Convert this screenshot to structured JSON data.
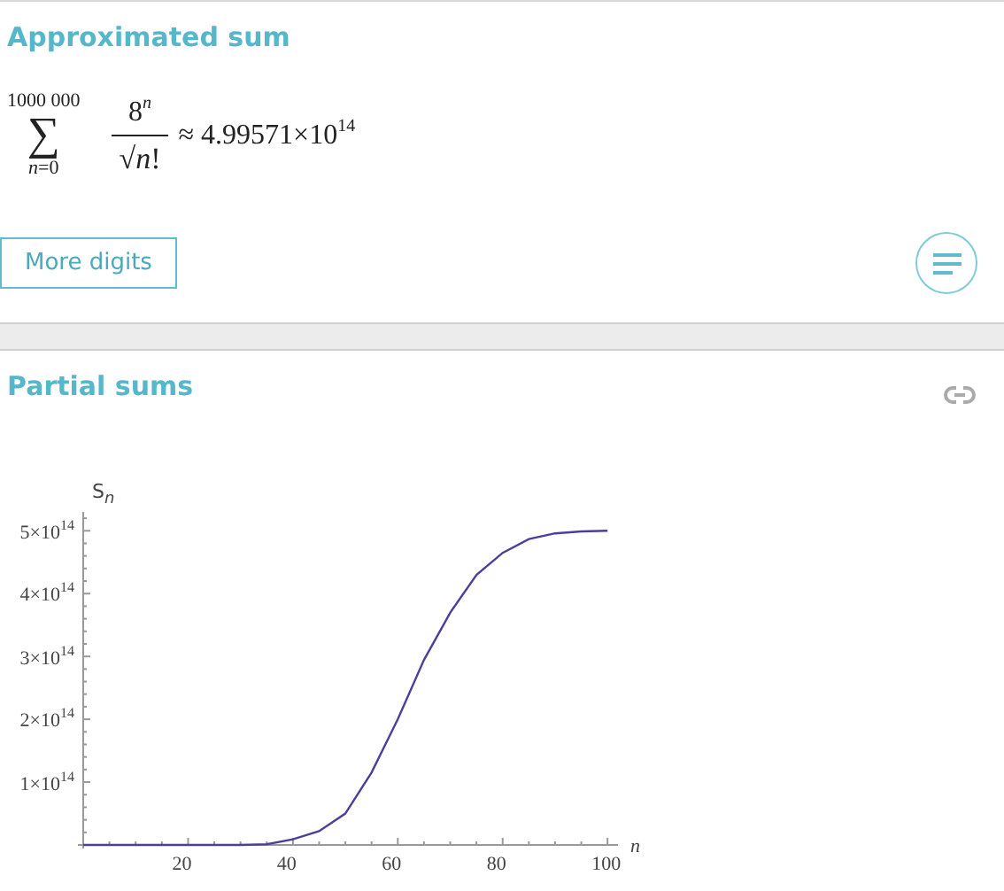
{
  "approximated_sum": {
    "title": "Approximated sum",
    "formula": {
      "sigma": "∑",
      "upper": "1000 000",
      "lower": "*n*=0",
      "numerator": "8$^{n}$",
      "radical": "√",
      "radicand": "*n*!",
      "result": "≈ 4.99571×10$^{14}$"
    },
    "more_digits_button": "More digits"
  },
  "partial_sums": {
    "title": "Partial sums",
    "chart_data": {
      "type": "line",
      "xlabel": "n",
      "ylabel": "S$_{n}$",
      "x": [
        0,
        5,
        10,
        15,
        20,
        25,
        30,
        35,
        40,
        45,
        50,
        55,
        60,
        65,
        70,
        75,
        80,
        85,
        90,
        95,
        100
      ],
      "series": [
        {
          "color": "#4b3f9e",
          "values": [
            0,
            0,
            0,
            0,
            0,
            0,
            0,
            1000000000000.0,
            9000000000000.0,
            22000000000000.0,
            50000000000000.0,
            115000000000000.0,
            200000000000000.0,
            295000000000000.0,
            370000000000000.0,
            430000000000000.0,
            465000000000000.0,
            487000000000000.0,
            496000000000000.0,
            499000000000000.0,
            500000000000000.0
          ]
        }
      ],
      "xlim": [
        0,
        102
      ],
      "ylim": [
        0,
        530000000000000.0
      ],
      "xticks": [
        20,
        40,
        60,
        80,
        100
      ],
      "yticks": [
        {
          "value": 100000000000000.0,
          "label": "1×10$^{14}$"
        },
        {
          "value": 200000000000000.0,
          "label": "2×10$^{14}$"
        },
        {
          "value": 300000000000000.0,
          "label": "3×10$^{14}$"
        },
        {
          "value": 400000000000000.0,
          "label": "4×10$^{14}$"
        },
        {
          "value": 500000000000000.0,
          "label": "5×10$^{14}$"
        }
      ]
    }
  }
}
